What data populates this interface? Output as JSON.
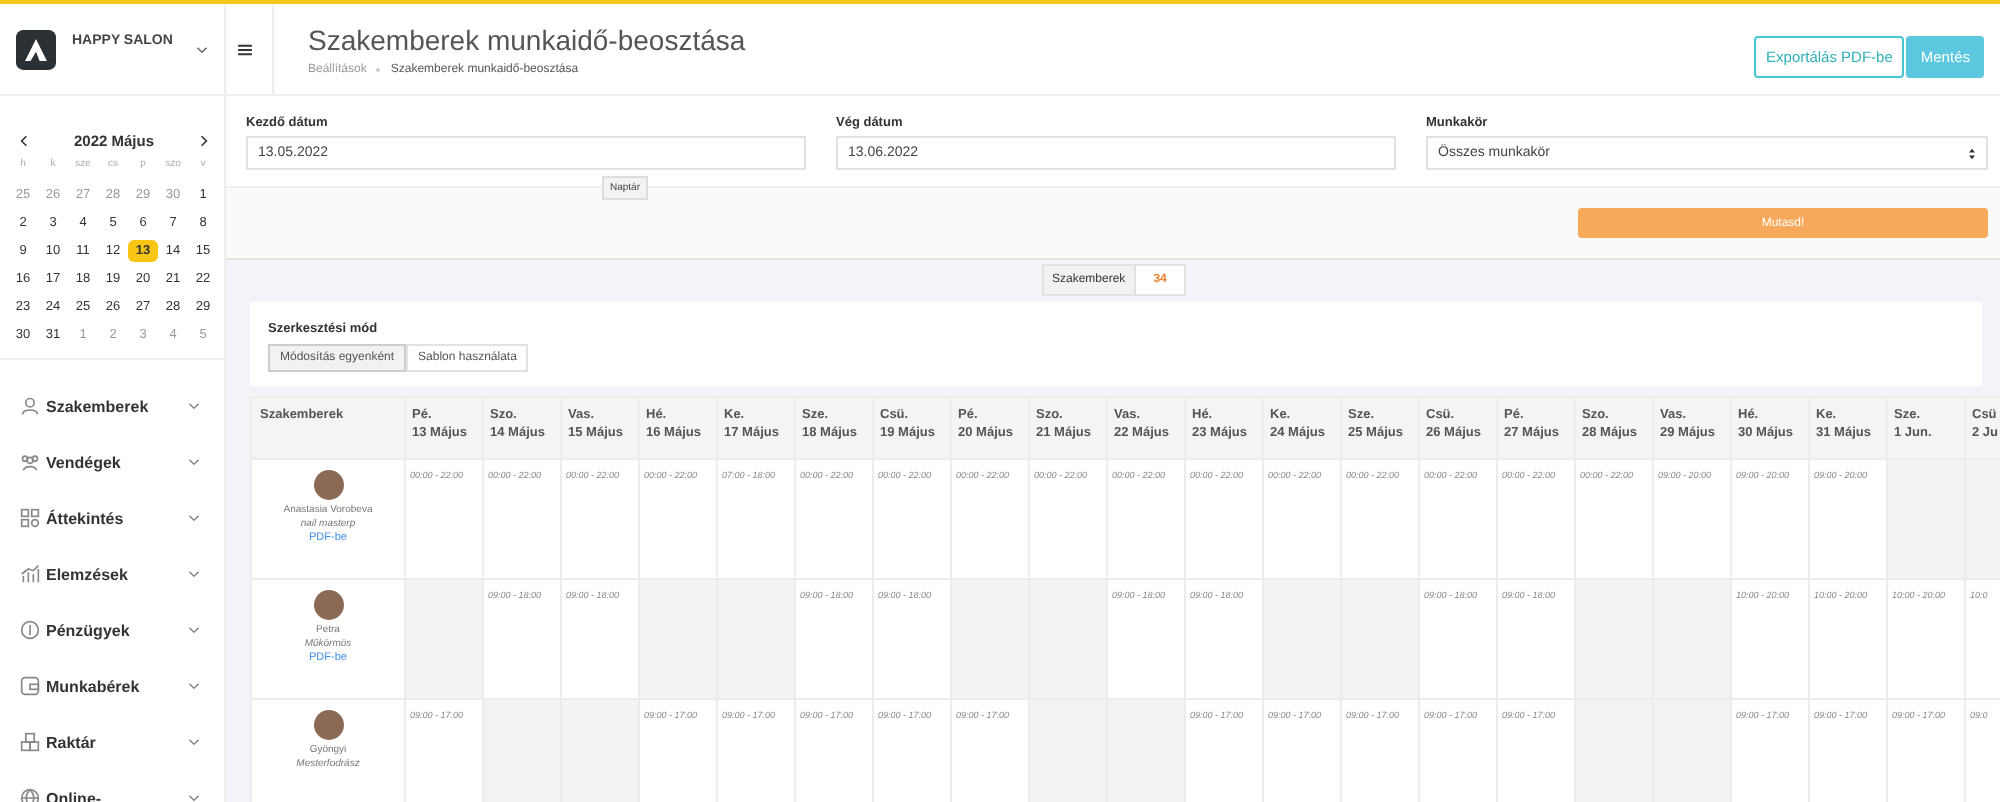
{
  "brand": {
    "name": "HAPPY SALON"
  },
  "calendar": {
    "title": "2022 Május",
    "weekdays": [
      "h",
      "k",
      "sze",
      "cs",
      "p",
      "szo",
      "v"
    ],
    "weeks": [
      [
        {
          "day": "25",
          "muted": true,
          "selected": false
        },
        {
          "day": "26",
          "muted": true,
          "selected": false
        },
        {
          "day": "27",
          "muted": true,
          "selected": false
        },
        {
          "day": "28",
          "muted": true,
          "selected": false
        },
        {
          "day": "29",
          "muted": true,
          "selected": false
        },
        {
          "day": "30",
          "muted": true,
          "selected": false
        },
        {
          "day": "1",
          "muted": false,
          "selected": false
        }
      ],
      [
        {
          "day": "2",
          "muted": false,
          "selected": false
        },
        {
          "day": "3",
          "muted": false,
          "selected": false
        },
        {
          "day": "4",
          "muted": false,
          "selected": false
        },
        {
          "day": "5",
          "muted": false,
          "selected": false
        },
        {
          "day": "6",
          "muted": false,
          "selected": false
        },
        {
          "day": "7",
          "muted": false,
          "selected": false
        },
        {
          "day": "8",
          "muted": false,
          "selected": false
        }
      ],
      [
        {
          "day": "9",
          "muted": false,
          "selected": false
        },
        {
          "day": "10",
          "muted": false,
          "selected": false
        },
        {
          "day": "11",
          "muted": false,
          "selected": false
        },
        {
          "day": "12",
          "muted": false,
          "selected": false
        },
        {
          "day": "13",
          "muted": false,
          "selected": true
        },
        {
          "day": "14",
          "muted": false,
          "selected": false
        },
        {
          "day": "15",
          "muted": false,
          "selected": false
        }
      ],
      [
        {
          "day": "16",
          "muted": false,
          "selected": false
        },
        {
          "day": "17",
          "muted": false,
          "selected": false
        },
        {
          "day": "18",
          "muted": false,
          "selected": false
        },
        {
          "day": "19",
          "muted": false,
          "selected": false
        },
        {
          "day": "20",
          "muted": false,
          "selected": false
        },
        {
          "day": "21",
          "muted": false,
          "selected": false
        },
        {
          "day": "22",
          "muted": false,
          "selected": false
        }
      ],
      [
        {
          "day": "23",
          "muted": false,
          "selected": false
        },
        {
          "day": "24",
          "muted": false,
          "selected": false
        },
        {
          "day": "25",
          "muted": false,
          "selected": false
        },
        {
          "day": "26",
          "muted": false,
          "selected": false
        },
        {
          "day": "27",
          "muted": false,
          "selected": false
        },
        {
          "day": "28",
          "muted": false,
          "selected": false
        },
        {
          "day": "29",
          "muted": false,
          "selected": false
        }
      ],
      [
        {
          "day": "30",
          "muted": false,
          "selected": false
        },
        {
          "day": "31",
          "muted": false,
          "selected": false
        },
        {
          "day": "1",
          "muted": true,
          "selected": false
        },
        {
          "day": "2",
          "muted": true,
          "selected": false
        },
        {
          "day": "3",
          "muted": true,
          "selected": false
        },
        {
          "day": "4",
          "muted": true,
          "selected": false
        },
        {
          "day": "5",
          "muted": true,
          "selected": false
        }
      ]
    ]
  },
  "sidebar": {
    "items": [
      {
        "label": "Szakemberek",
        "kind": "person"
      },
      {
        "label": "Vendégek",
        "kind": "people"
      },
      {
        "label": "Áttekintés",
        "kind": "grid"
      },
      {
        "label": "Elemzések",
        "kind": "chart"
      },
      {
        "label": "Pénzügyek",
        "kind": "coin"
      },
      {
        "label": "Munkabérek",
        "kind": "wallet"
      },
      {
        "label": "Raktár",
        "kind": "boxes"
      },
      {
        "label": "Online-",
        "kind": "globe"
      }
    ]
  },
  "header": {
    "title": "Szakemberek munkaidő-beosztása",
    "breadcrumb": [
      "Beállítások",
      "Szakemberek munkaidő-beosztása"
    ],
    "export_button": "Exportálás PDF-be",
    "save_button": "Mentés"
  },
  "filters": {
    "start": {
      "label": "Kezdő dátum",
      "value": "13.05.2022",
      "tooltip": "Naptár"
    },
    "end": {
      "label": "Vég dátum",
      "value": "13.06.2022"
    },
    "role": {
      "label": "Munkakör",
      "value": "Összes munkakör"
    },
    "show_button": "Mutasd!"
  },
  "counter": {
    "label": "Szakemberek",
    "count": "34"
  },
  "edit_mode": {
    "title": "Szerkesztési mód",
    "options": [
      {
        "label": "Módosítás egyenként",
        "selected": true
      },
      {
        "label": "Sablon használata",
        "selected": false
      }
    ]
  },
  "table": {
    "first_column": "Szakemberek",
    "columns": [
      {
        "weekday": "Pé.",
        "date": "13 Május"
      },
      {
        "weekday": "Szo.",
        "date": "14 Május"
      },
      {
        "weekday": "Vas.",
        "date": "15 Május"
      },
      {
        "weekday": "Hé.",
        "date": "16 Május"
      },
      {
        "weekday": "Ke.",
        "date": "17 Május"
      },
      {
        "weekday": "Sze.",
        "date": "18 Május"
      },
      {
        "weekday": "Csü.",
        "date": "19 Május"
      },
      {
        "weekday": "Pé.",
        "date": "20 Május"
      },
      {
        "weekday": "Szo.",
        "date": "21 Május"
      },
      {
        "weekday": "Vas.",
        "date": "22 Május"
      },
      {
        "weekday": "Hé.",
        "date": "23 Május"
      },
      {
        "weekday": "Ke.",
        "date": "24 Május"
      },
      {
        "weekday": "Sze.",
        "date": "25 Május"
      },
      {
        "weekday": "Csü.",
        "date": "26 Május"
      },
      {
        "weekday": "Pé.",
        "date": "27 Május"
      },
      {
        "weekday": "Szo.",
        "date": "28 Május"
      },
      {
        "weekday": "Vas.",
        "date": "29 Május"
      },
      {
        "weekday": "Hé.",
        "date": "30 Május"
      },
      {
        "weekday": "Ke.",
        "date": "31 Május"
      },
      {
        "weekday": "Sze.",
        "date": "1 Jun."
      },
      {
        "weekday": "Csü",
        "date": "2 Ju"
      }
    ],
    "rows": [
      {
        "name": "Anastasia Vorobeva",
        "role": "nail masterp",
        "link": "PDF-be",
        "cells": [
          {
            "time": "00:00 - 22:00",
            "off": false
          },
          {
            "time": "00:00 - 22:00",
            "off": false
          },
          {
            "time": "00:00 - 22:00",
            "off": false
          },
          {
            "time": "00:00 - 22:00",
            "off": false
          },
          {
            "time": "07:00 - 18:00",
            "off": false
          },
          {
            "time": "00:00 - 22:00",
            "off": false
          },
          {
            "time": "00:00 - 22:00",
            "off": false
          },
          {
            "time": "00:00 - 22:00",
            "off": false
          },
          {
            "time": "00:00 - 22:00",
            "off": false
          },
          {
            "time": "00:00 - 22:00",
            "off": false
          },
          {
            "time": "00:00 - 22:00",
            "off": false
          },
          {
            "time": "00:00 - 22:00",
            "off": false
          },
          {
            "time": "00:00 - 22:00",
            "off": false
          },
          {
            "time": "00:00 - 22:00",
            "off": false
          },
          {
            "time": "00:00 - 22:00",
            "off": false
          },
          {
            "time": "00:00 - 22:00",
            "off": false
          },
          {
            "time": "09:00 - 20:00",
            "off": false
          },
          {
            "time": "09:00 - 20:00",
            "off": false
          },
          {
            "time": "09:00 - 20:00",
            "off": false
          },
          {
            "off": true
          },
          {
            "off": true
          }
        ]
      },
      {
        "name": "Petra",
        "role": "Műkörmös",
        "link": "PDF-be",
        "cells": [
          {
            "off": true
          },
          {
            "time": "09:00 - 18:00",
            "off": false
          },
          {
            "time": "09:00 - 18:00",
            "off": false
          },
          {
            "off": true
          },
          {
            "off": true
          },
          {
            "time": "09:00 - 18:00",
            "off": false
          },
          {
            "time": "09:00 - 18:00",
            "off": false
          },
          {
            "off": true
          },
          {
            "off": true
          },
          {
            "time": "09:00 - 18:00",
            "off": false
          },
          {
            "time": "09:00 - 18:00",
            "off": false
          },
          {
            "off": true
          },
          {
            "off": true
          },
          {
            "time": "09:00 - 18:00",
            "off": false
          },
          {
            "time": "09:00 - 18:00",
            "off": false
          },
          {
            "off": true
          },
          {
            "off": true
          },
          {
            "time": "10:00 - 20:00",
            "off": false
          },
          {
            "time": "10:00 - 20:00",
            "off": false
          },
          {
            "time": "10:00 - 20:00",
            "off": false
          },
          {
            "time": "10:0",
            "off": false
          }
        ]
      },
      {
        "name": "Gyöngyi",
        "role": "Mesterfodrász",
        "cells": [
          {
            "time": "09:00 - 17:00",
            "off": false
          },
          {
            "off": true
          },
          {
            "off": true
          },
          {
            "time": "09:00 - 17:00",
            "off": false
          },
          {
            "time": "09:00 - 17:00",
            "off": false
          },
          {
            "time": "09:00 - 17:00",
            "off": false
          },
          {
            "time": "09:00 - 17:00",
            "off": false
          },
          {
            "time": "09:00 - 17:00",
            "off": false
          },
          {
            "off": true
          },
          {
            "off": true
          },
          {
            "time": "09:00 - 17:00",
            "off": false
          },
          {
            "time": "09:00 - 17:00",
            "off": false
          },
          {
            "time": "09:00 - 17:00",
            "off": false
          },
          {
            "time": "09:00 - 17:00",
            "off": false
          },
          {
            "time": "09:00 - 17:00",
            "off": false
          },
          {
            "off": true
          },
          {
            "off": true
          },
          {
            "time": "09:00 - 17:00",
            "off": false
          },
          {
            "time": "09:00 - 17:00",
            "off": false
          },
          {
            "time": "09:00 - 17:00",
            "off": false
          },
          {
            "time": "09:0",
            "off": false
          }
        ]
      }
    ]
  }
}
